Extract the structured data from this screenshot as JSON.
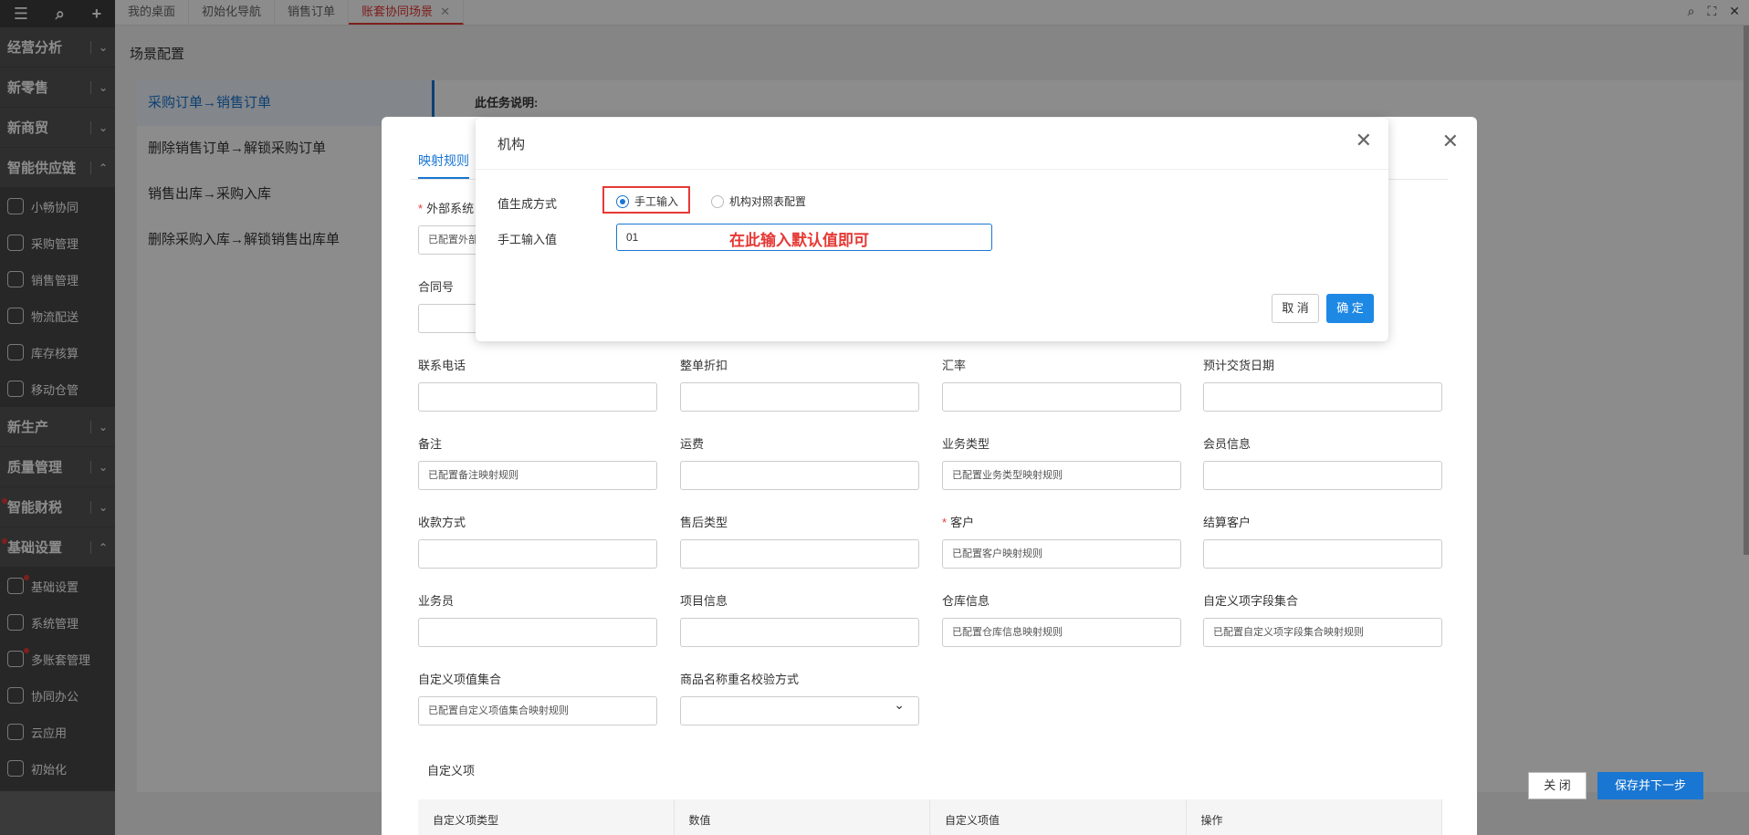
{
  "tabs": [
    {
      "label": "我的桌面"
    },
    {
      "label": "初始化导航"
    },
    {
      "label": "销售订单"
    },
    {
      "label": "账套协同场景"
    }
  ],
  "sidebar": {
    "groups_top": [
      {
        "label": "经营分析"
      },
      {
        "label": "新零售"
      },
      {
        "label": "新商贸"
      },
      {
        "label": "智能供应链"
      }
    ],
    "supply_items": [
      {
        "label": "小畅协同",
        "icon": "collab-icon"
      },
      {
        "label": "采购管理",
        "icon": "cart-icon"
      },
      {
        "label": "销售管理",
        "icon": "chart-icon"
      },
      {
        "label": "物流配送",
        "icon": "truck-icon"
      },
      {
        "label": "库存核算",
        "icon": "warehouse-icon"
      },
      {
        "label": "移动仓管",
        "icon": "mobile-warehouse-icon"
      }
    ],
    "groups_mid": [
      {
        "label": "新生产"
      },
      {
        "label": "质量管理"
      },
      {
        "label": "智能财税"
      },
      {
        "label": "基础设置"
      }
    ],
    "base_items": [
      {
        "label": "基础设置",
        "icon": "settings-icon"
      },
      {
        "label": "系统管理",
        "icon": "system-icon"
      },
      {
        "label": "多账套管理",
        "icon": "multi-ledger-icon"
      },
      {
        "label": "协同办公",
        "icon": "office-icon"
      },
      {
        "label": "云应用",
        "icon": "cloud-icon"
      },
      {
        "label": "初始化",
        "icon": "init-icon"
      }
    ]
  },
  "page": {
    "title": "场景配置",
    "nav": [
      {
        "label": "采购订单→销售订单"
      },
      {
        "label": "删除销售订单→解锁采购订单"
      },
      {
        "label": "销售出库→采购入库"
      },
      {
        "label": "删除采购入库→解锁销售出库单"
      }
    ],
    "info_title": "此任务说明:"
  },
  "panel": {
    "tab": "映射规则",
    "fields": [
      {
        "label": "外部系统",
        "required": true,
        "value": "已配置外部"
      },
      {
        "label": "合同号",
        "value": ""
      },
      {
        "label": "联系电话",
        "value": ""
      },
      {
        "label": "整单折扣",
        "value": ""
      },
      {
        "label": "汇率",
        "value": ""
      },
      {
        "label": "预计交货日期",
        "value": ""
      },
      {
        "label": "备注",
        "value": "已配置备注映射规则"
      },
      {
        "label": "运费",
        "value": ""
      },
      {
        "label": "业务类型",
        "value": "已配置业务类型映射规则"
      },
      {
        "label": "会员信息",
        "value": ""
      },
      {
        "label": "收款方式",
        "value": ""
      },
      {
        "label": "售后类型",
        "value": ""
      },
      {
        "label": "客户",
        "required": true,
        "value": "已配置客户映射规则"
      },
      {
        "label": "结算客户",
        "value": ""
      },
      {
        "label": "业务员",
        "value": ""
      },
      {
        "label": "项目信息",
        "value": ""
      },
      {
        "label": "仓库信息",
        "value": "已配置仓库信息映射规则"
      },
      {
        "label": "自定义项字段集合",
        "value": "已配置自定义项字段集合映射规则"
      },
      {
        "label": "自定义项值集合",
        "value": "已配置自定义项值集合映射规则"
      },
      {
        "label": "商品名称重名校验方式",
        "value": ""
      }
    ],
    "custom_title": "自定义项",
    "table_headers": [
      "自定义项类型",
      "数值",
      "自定义项值",
      "操作"
    ],
    "close_label": "关 闭",
    "next_label": "保存并下一步"
  },
  "dialog": {
    "title": "机构",
    "gen_label": "值生成方式",
    "radio_manual": "手工输入",
    "radio_table": "机构对照表配置",
    "input_label": "手工输入值",
    "input_value": "01",
    "hint": "在此输入默认值即可",
    "cancel": "取 消",
    "ok": "确 定"
  },
  "colors": {
    "accent": "#1976d2",
    "highlight": "#e53935"
  }
}
